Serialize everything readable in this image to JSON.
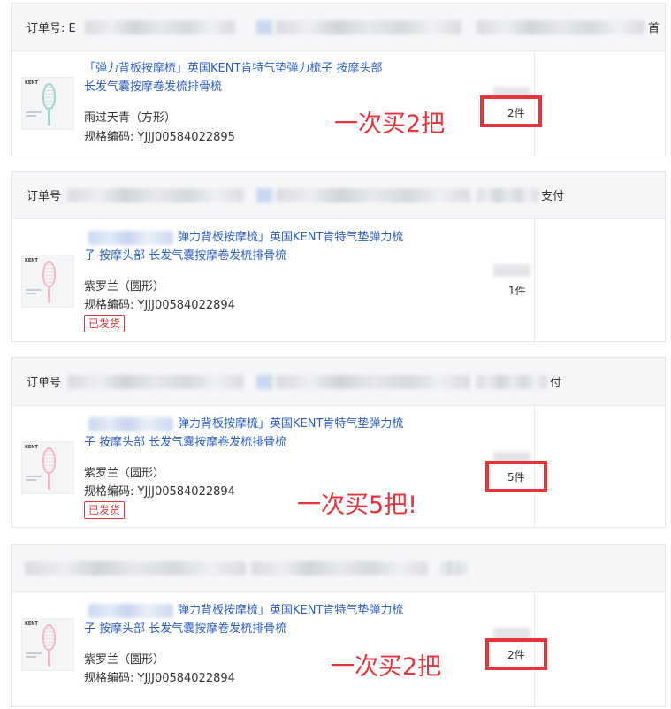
{
  "orders": [
    {
      "order_label": "订单号: E",
      "header_tail": "首",
      "title": "「弹力背板按摩梳」英国KENT肯特气垫弹力梳子 按摩头部长发气囊按摩卷发梳排骨梳",
      "title_line1": "「弹力背板按摩梳」英国KENT肯特气垫弹力梳子 按摩头部",
      "title_line2": "长发气囊按摩卷发梳排骨梳",
      "sku_name": "雨过天青（方形）",
      "sku_code": "规格编码: YJJJ00584022895",
      "quantity": "2件",
      "annotation": "一次买2把",
      "shipped": ""
    },
    {
      "order_label": "订单号",
      "header_tail": "支付",
      "title_line1": "弹力背板按摩梳」英国KENT肯特气垫弹力梳",
      "title_line2": "子 按摩头部 长发气囊按摩卷发梳排骨梳",
      "sku_name": "紫罗兰（圆形）",
      "sku_code": "规格编码: YJJJ00584022894",
      "quantity": "1件",
      "annotation": "",
      "shipped": "已发货"
    },
    {
      "order_label": "订单号",
      "header_tail": "付",
      "title_line1": "弹力背板按摩梳」英国KENT肯特气垫弹力梳",
      "title_line2": "子 按摩头部 长发气囊按摩卷发梳排骨梳",
      "sku_name": "紫罗兰（圆形）",
      "sku_code": "规格编码: YJJJ00584022894",
      "quantity": "5件",
      "annotation": "一次买5把!",
      "shipped": "已发货"
    },
    {
      "order_label": "",
      "header_tail": "",
      "title_line1": "弹力背板按摩梳」英国KENT肯特气垫弹力梳",
      "title_line2": "子 按摩头部 长发气囊按摩卷发梳排骨梳",
      "sku_name": "紫罗兰（圆形）",
      "sku_code": "规格编码: YJJJ00584022894",
      "quantity": "2件",
      "annotation": "一次买2把",
      "shipped": ""
    }
  ],
  "brand_mark": "KENT",
  "colors": {
    "link": "#2f5fc4",
    "annotation_red": "#e8333a",
    "tag_red": "#e0393e",
    "header_bg": "#f5f6f8"
  }
}
